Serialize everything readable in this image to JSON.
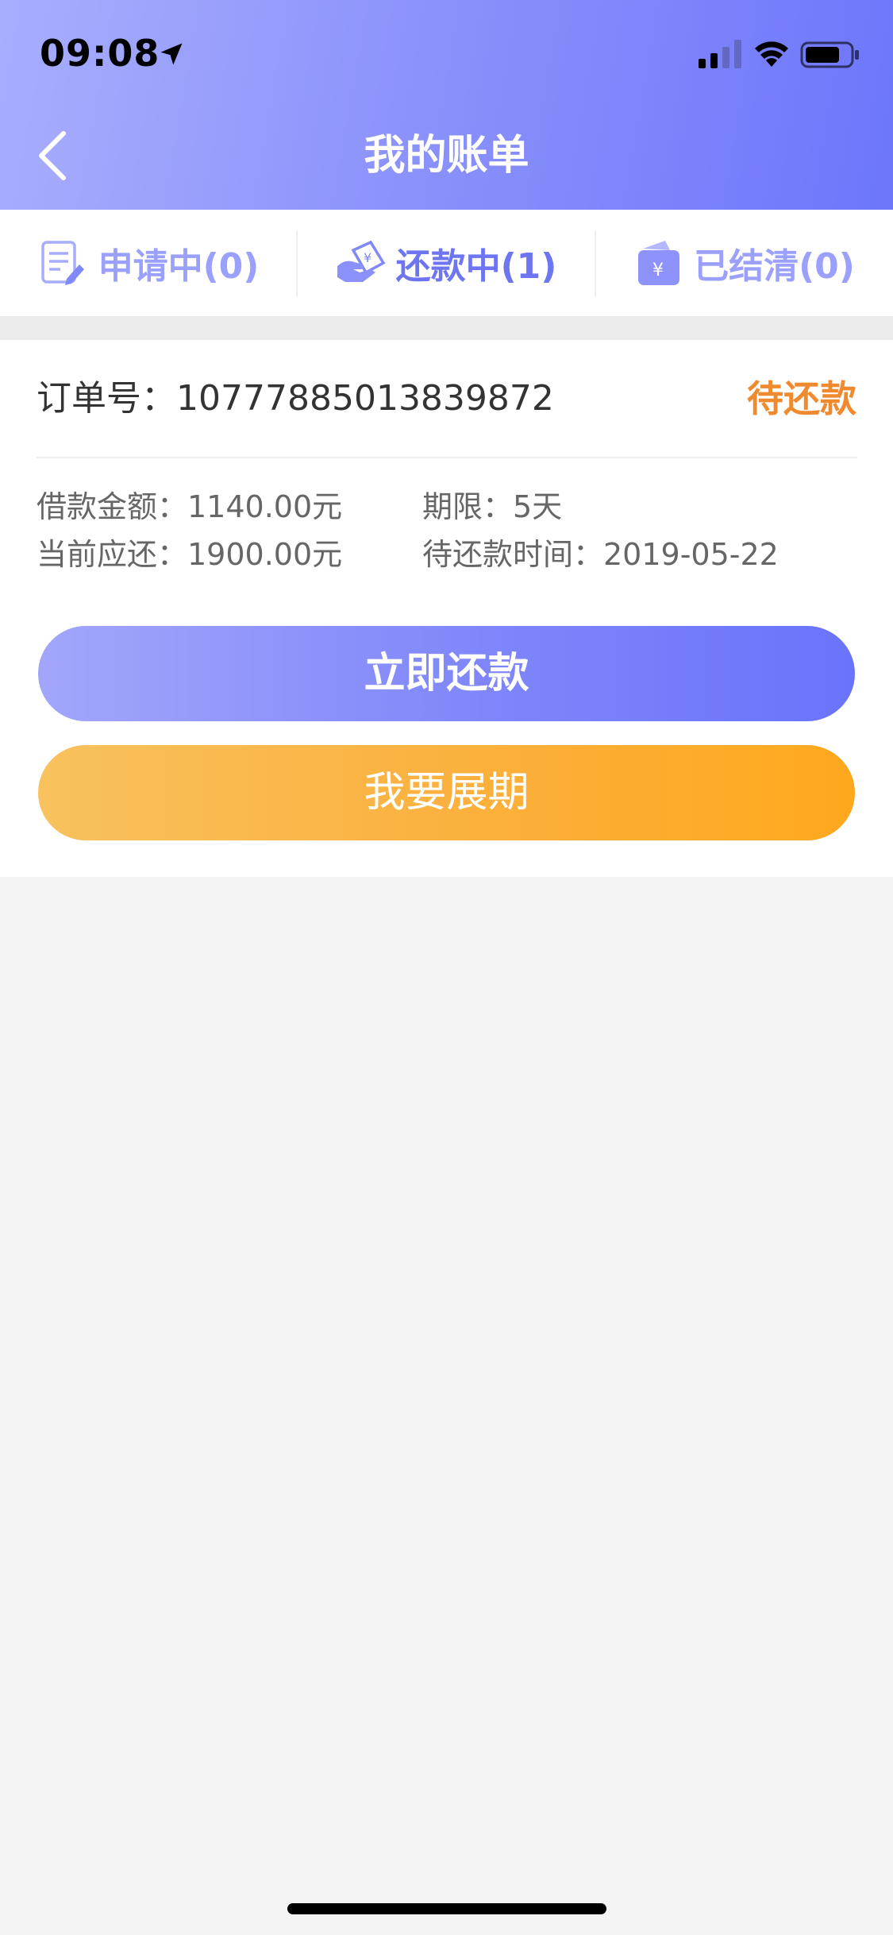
{
  "status_bar": {
    "time": "09:08",
    "icons": [
      "location-arrow-icon",
      "signal-icon",
      "wifi-icon",
      "battery-icon"
    ]
  },
  "header": {
    "title": "我的账单",
    "back_icon": "chevron-left-icon",
    "gradient_colors": [
      "#a8aefd",
      "#6d76fb"
    ]
  },
  "tabs": [
    {
      "label": "申请中(0)",
      "icon": "application-form-icon",
      "active": false
    },
    {
      "label": "还款中(1)",
      "icon": "repayment-hands-icon",
      "active": true
    },
    {
      "label": "已结清(0)",
      "icon": "wallet-yen-icon",
      "active": false
    }
  ],
  "order": {
    "number_label": "订单号：10777885013839872",
    "status": "待还款",
    "loan_amount": "借款金额：1140.00元",
    "term": "期限：5天",
    "current_due": "当前应还：1900.00元",
    "due_date": "待还款时间：2019-05-22"
  },
  "buttons": {
    "repay": "立即还款",
    "extend": "我要展期"
  },
  "colors": {
    "accent": "#6e75f0",
    "status_orange": "#f08a2f",
    "extend_orange": "#fea81d",
    "page_bg": "#f4f4f4"
  }
}
